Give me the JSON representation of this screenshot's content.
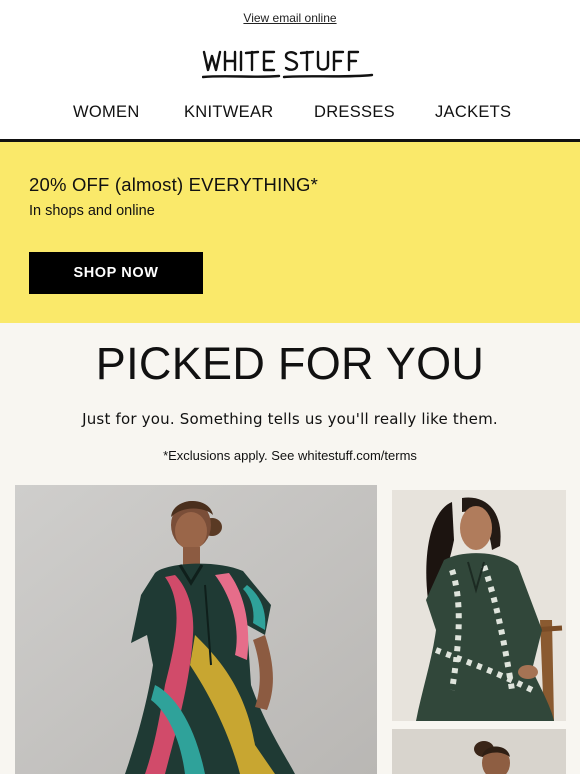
{
  "header": {
    "view_online": "View email online",
    "brand": "WHITE STUFF"
  },
  "nav": {
    "items": [
      {
        "label": "WOMEN"
      },
      {
        "label": "KNITWEAR"
      },
      {
        "label": "DRESSES"
      },
      {
        "label": "JACKETS"
      }
    ]
  },
  "promo": {
    "title": "20% OFF (almost) EVERYTHING*",
    "subtitle": "In shops and online",
    "button": "SHOP NOW",
    "background": "#fae96a"
  },
  "picked": {
    "title": "PICKED FOR YOU",
    "subtitle": "Just for you. Something tells us you'll really like them.",
    "note": "*Exclusions apply. See whitestuff.com/terms",
    "background": "#f8f6f1"
  },
  "products": [
    {
      "image": "woman in multicoloured tropical leaf print shirt dress"
    },
    {
      "image": "woman in green and white leaf print shirt dress, seated"
    },
    {
      "image": "woman with hair in a bun, partially visible"
    }
  ]
}
